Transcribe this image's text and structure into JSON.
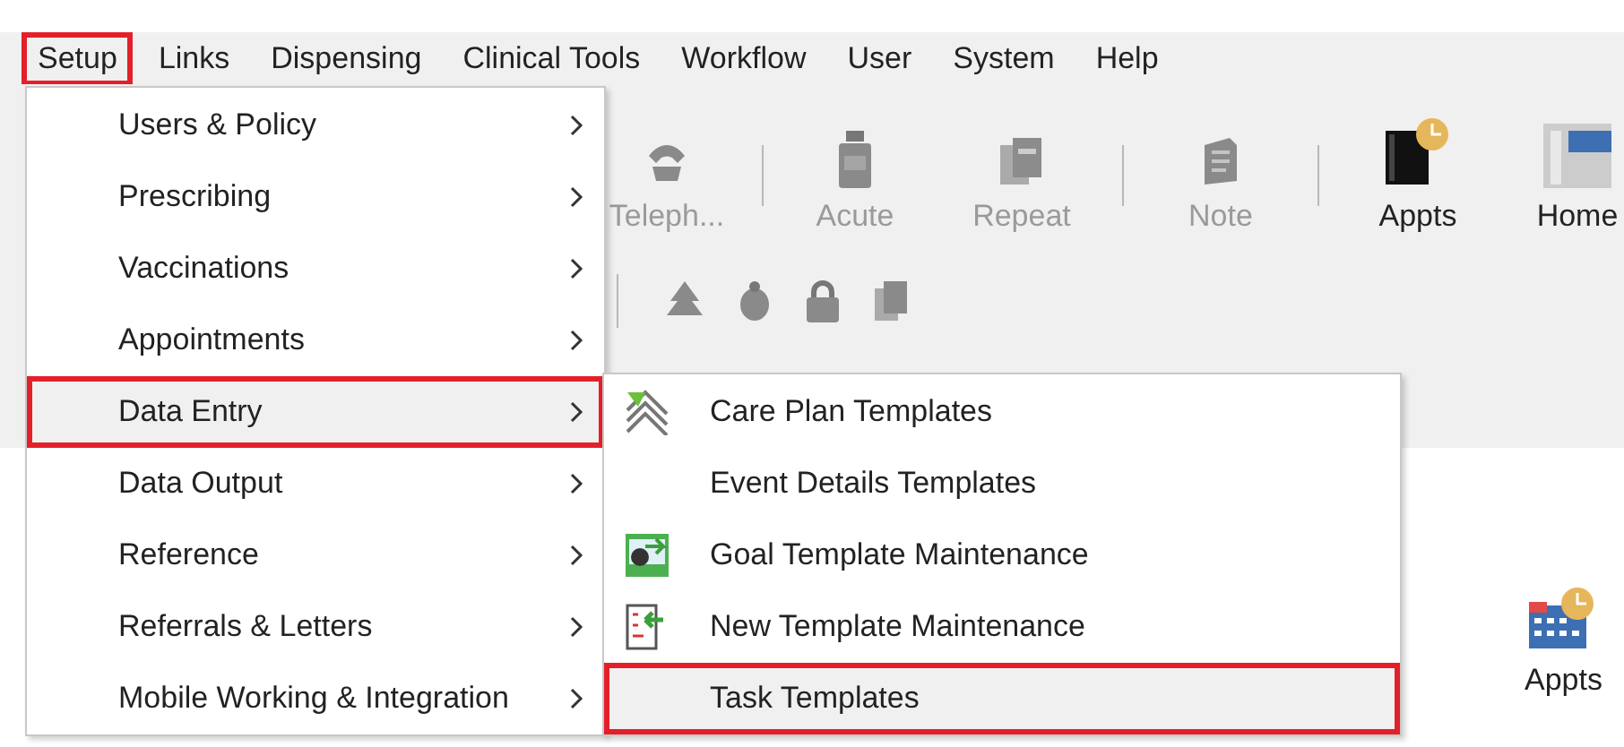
{
  "menu_bar": [
    {
      "label": "Setup",
      "selected": true
    },
    {
      "label": "Links",
      "selected": false
    },
    {
      "label": "Dispensing",
      "selected": false
    },
    {
      "label": "Clinical Tools",
      "selected": false
    },
    {
      "label": "Workflow",
      "selected": false
    },
    {
      "label": "User",
      "selected": false
    },
    {
      "label": "System",
      "selected": false
    },
    {
      "label": "Help",
      "selected": false
    }
  ],
  "toolbar": [
    {
      "label": "Teleph...",
      "kind": "phone",
      "disabled": true
    },
    {
      "label": "Acute",
      "kind": "bottle",
      "disabled": true,
      "separator_before": true
    },
    {
      "label": "Repeat",
      "kind": "repeat",
      "disabled": true
    },
    {
      "label": "Note",
      "kind": "note",
      "disabled": true,
      "separator_before": true
    },
    {
      "label": "Appts",
      "kind": "appts",
      "disabled": false,
      "separator_before": true
    },
    {
      "label": "Home",
      "kind": "home",
      "disabled": false
    }
  ],
  "small_toolbar": [
    {
      "kind": "tree"
    },
    {
      "kind": "bug"
    },
    {
      "kind": "lock"
    },
    {
      "kind": "pages"
    }
  ],
  "panel_button": {
    "label": "Appts"
  },
  "setup_menu": [
    {
      "label": "Users & Policy",
      "selected": false
    },
    {
      "label": "Prescribing",
      "selected": false
    },
    {
      "label": "Vaccinations",
      "selected": false
    },
    {
      "label": "Appointments",
      "selected": false
    },
    {
      "label": "Data Entry",
      "selected": true
    },
    {
      "label": "Data Output",
      "selected": false
    },
    {
      "label": "Reference",
      "selected": false
    },
    {
      "label": "Referrals & Letters",
      "selected": false
    },
    {
      "label": "Mobile Working & Integration",
      "selected": false
    }
  ],
  "data_entry_menu": [
    {
      "label": "Care Plan Templates",
      "kind": "care-plan",
      "selected": false
    },
    {
      "label": "Event Details Templates",
      "kind": "none",
      "selected": false
    },
    {
      "label": "Goal Template Maintenance",
      "kind": "goal",
      "selected": false
    },
    {
      "label": "New Template Maintenance",
      "kind": "new-template",
      "selected": false
    },
    {
      "label": "Task Templates",
      "kind": "none",
      "selected": true
    }
  ]
}
